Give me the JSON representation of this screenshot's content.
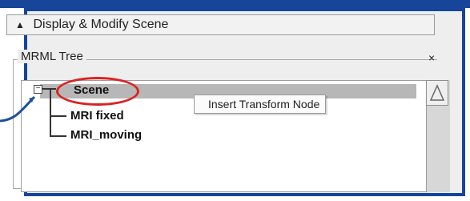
{
  "panel": {
    "title": "Display & Modify Scene",
    "collapse_icon": "caret-up-icon",
    "section_label": "MRML Tree",
    "close_label": "×"
  },
  "tree": {
    "nodes": [
      {
        "label": "Scene",
        "level": 0,
        "highlighted": true
      },
      {
        "label": "MRI fixed",
        "level": 1,
        "highlighted": false
      },
      {
        "label": "MRI_moving",
        "level": 1,
        "highlighted": false
      }
    ],
    "expander_symbol": "−"
  },
  "context_menu": {
    "item": "Insert Transform Node"
  },
  "colors": {
    "brand_blue": "#16459a",
    "highlight_red": "#d92522",
    "selection_gray": "#b7b7b7"
  }
}
